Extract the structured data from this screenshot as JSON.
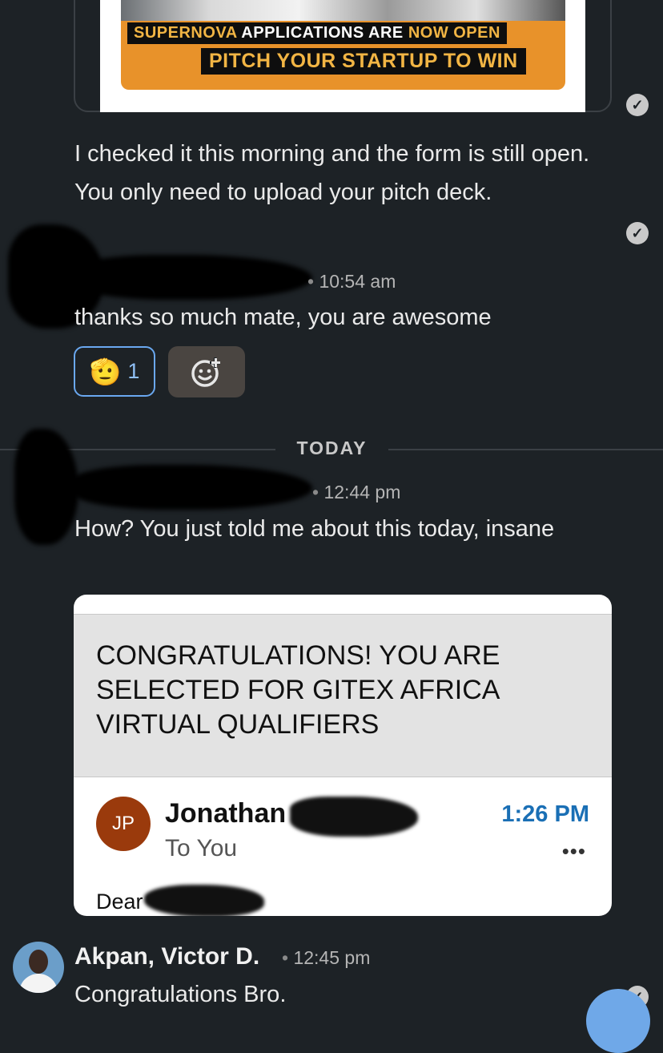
{
  "shared_image": {
    "banner_line1_bold": "SUPERNOVA",
    "banner_line1_rest": "APPLICATIONS ARE",
    "banner_line1_end": "NOW OPEN",
    "banner_line2": "PITCH YOUR STARTUP TO WIN"
  },
  "messages": [
    {
      "text": "I checked it this morning and the form is still open. You only need to upload your pitch deck."
    },
    {
      "time": "10:54 am",
      "text": "thanks so much mate, you are awesome",
      "reaction": {
        "emoji": "🫡",
        "count": "1"
      }
    }
  ],
  "date_divider": "TODAY",
  "message_today": {
    "time": "12:44 pm",
    "text": "How? You just told me about this today, insane"
  },
  "email_preview": {
    "subject": "CONGRATULATIONS! YOU ARE SELECTED FOR GITEX AFRICA VIRTUAL QUALIFIERS",
    "avatar_initials": "JP",
    "sender": "Jonathan",
    "recipient": "To You",
    "time": "1:26 PM",
    "more": "•••",
    "body_start": "Dear"
  },
  "last_message": {
    "sender": "Akpan, Victor D.",
    "time": "12:45 pm",
    "text": "Congratulations Bro."
  },
  "icons": {
    "read_receipt": "check-circle-icon",
    "add_reaction": "add-emoji-icon"
  },
  "colors": {
    "background": "#1d2226",
    "reaction_border": "#6aa8f0",
    "email_time": "#1a6fb5",
    "avatar_jp": "#9a3a0c"
  }
}
